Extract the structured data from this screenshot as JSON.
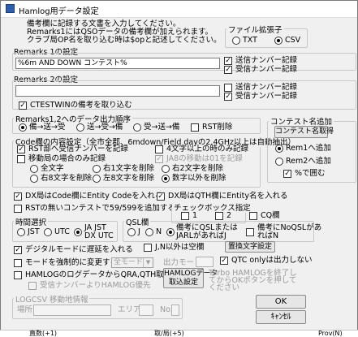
{
  "title": "Hamlog用データ設定",
  "intro": [
    "備考欄に記録する文書を入力してください。",
    "Remarks1にはQSOデータの備考欄が加えられます。",
    "クラブ局OP名を取り込む時は$opと記述してください。"
  ],
  "file_ext": {
    "label": "ファイル拡張子",
    "txt": "TXT",
    "csv": "CSV"
  },
  "remarks1": {
    "label": "Remarks 1の設定",
    "value": "%6m AND DOWN コンテスト%",
    "send": "送信ナンバー記録",
    "recv": "受信ナンバー記録"
  },
  "remarks2": {
    "label": "Remarks 2の設定",
    "value": "",
    "send": "送信ナンバー記録",
    "recv": "受信ナンバー記録",
    "ctestwin": "CTESTWINの備考を取り込む"
  },
  "order": {
    "label": "Remarks1,2へのデータ出力順序",
    "opt1": "備→送→受",
    "opt2": "送→受→備",
    "opt3": "受→送→備",
    "rst": "RST削除"
  },
  "code": {
    "label": "Code欄の内容設定（全市全郡、6mdown/Field dayの2.4GHz以上は自動抽出）",
    "rst": "RST部へ受信ナンバーを記録",
    "four": "4文字以上の時のみ記録",
    "move": "移動局の場合のみ記録",
    "ja8": "JA8の移動は01を記録",
    "all": "全文字",
    "right1": "右1文字を削除",
    "right2": "右2文字を削除",
    "right8": "右8文字を削除",
    "left8": "左8文字を削除",
    "numonly": "数字以外を削除"
  },
  "contest_name": {
    "label": "コンテスト名追加",
    "button": "コンテスト名取得",
    "rem1": "Rem1へ追加",
    "rem2": "Rem2へ追加",
    "pct": "%で囲む"
  },
  "dx_code": "DX局はCode欄にEntity Codeを入れる",
  "dx_qth": "DX局はQTH欄にEntity名を入れる",
  "rst_note": "RSTの無いコンテストで59/599を追加する",
  "checkbox": {
    "label": "チェックボックス指定",
    "one": "1",
    "two": "2",
    "cq": "CQ欄"
  },
  "time": {
    "label": "時間選択",
    "jst": "JST",
    "utc": "UTC",
    "jajst": "JA JST",
    "dxutc": "DX UTC"
  },
  "qsl": {
    "label": "QSL欄",
    "j": "J",
    "n": "N",
    "opt1a": "備考にQSLまたは",
    "opt1b": "JARLがあればJ",
    "opt2a": "備考にNoQSLがあ",
    "opt2b": "ればN",
    "jn": "J,N以外は空欄",
    "replace": "置換文字設定"
  },
  "digital": "デジタルモードに遅延を入れる",
  "force_mode": "モードを強制的に変更する",
  "mode_select": "全モード",
  "power_label": "出力モード",
  "qtc": "QTC onlyは出力しない",
  "hamlog_qrz": "HAMLOGのログデータからQRA,QTH取込む",
  "recv_hamlog": "受信ナンバーよりHAMLOG優先",
  "hamlog_btn": [
    "HAMLOGデータ",
    "取込設定"
  ],
  "turbo": [
    "Turbo HAMLOGを終了し",
    "てからOKボタンを押して",
    "ください"
  ],
  "logcsv": {
    "label": "LOGCSV 移動地情報",
    "place": "場所",
    "area": "エリア",
    "no": "No."
  },
  "ok": "OK",
  "cancel": "ｷｬﾝｾﾙ",
  "bottom": {
    "left": "直数(+1)",
    "mid": "取/局(+5)",
    "right": "Prov(N)"
  }
}
